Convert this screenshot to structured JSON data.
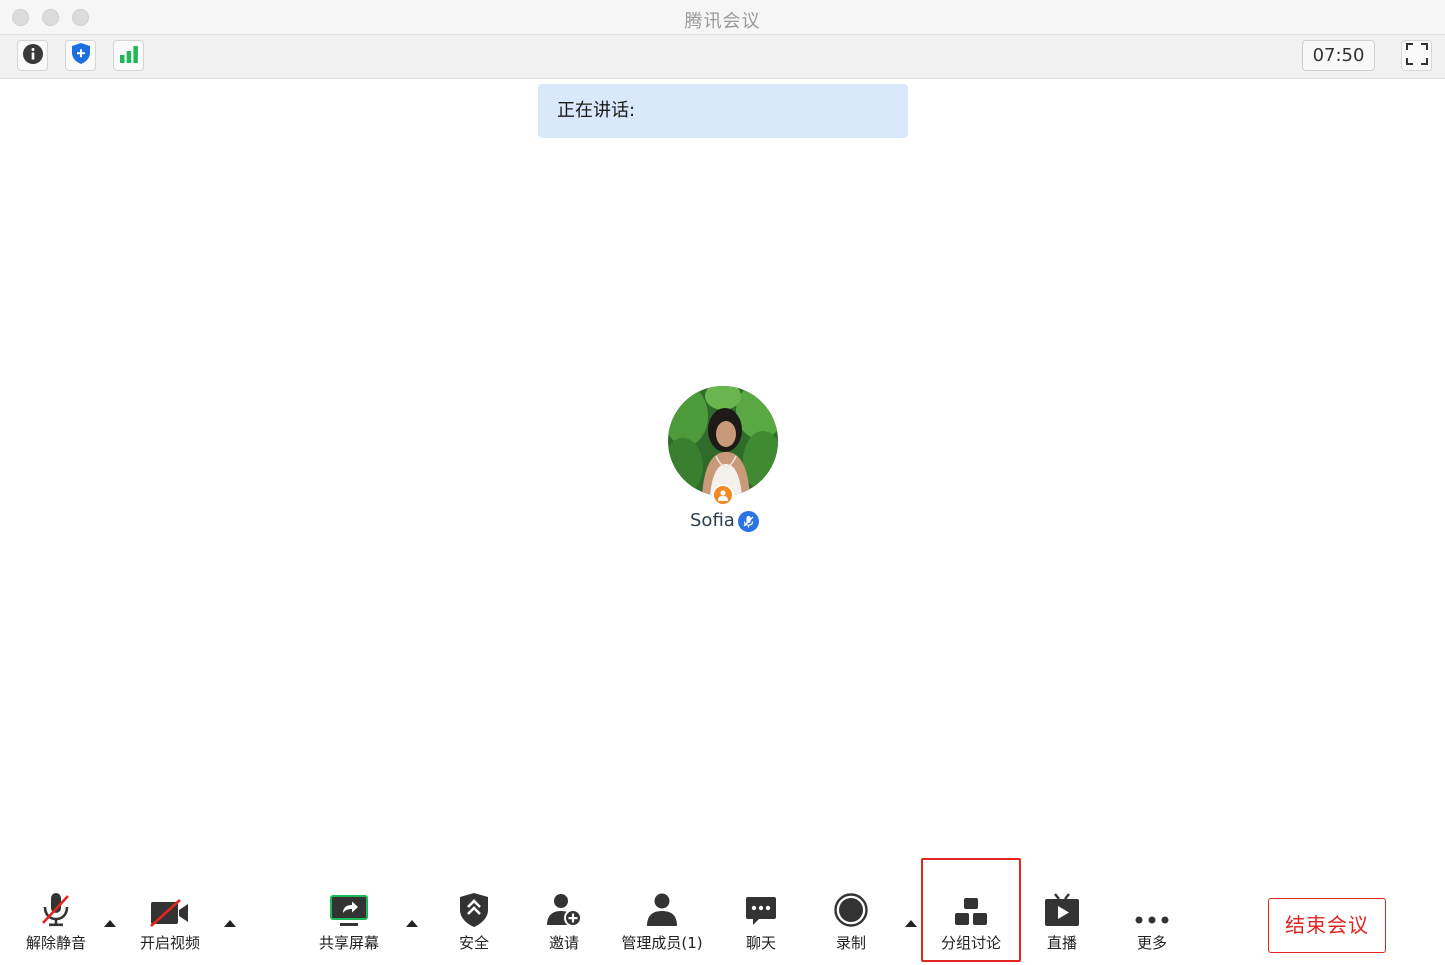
{
  "window": {
    "title": "腾讯会议"
  },
  "infobar": {
    "info_icon": "info-icon",
    "security_icon": "shield-icon",
    "signal_icon": "signal-bars-icon",
    "timer": "07:50",
    "fullscreen_icon": "fullscreen-icon"
  },
  "speaking": {
    "label": "正在讲话:"
  },
  "participant": {
    "name": "Sofia",
    "role_icon": "host-icon",
    "mic_icon": "microphone-icon"
  },
  "toolbar": {
    "unmute": "解除静音",
    "video": "开启视频",
    "share": "共享屏幕",
    "security": "安全",
    "invite": "邀请",
    "members": "管理成员(1)",
    "chat": "聊天",
    "record": "录制",
    "breakout": "分组讨论",
    "live": "直播",
    "more": "更多",
    "end": "结束会议"
  },
  "colors": {
    "accent_red": "#e0261f",
    "banner_blue": "#d9e9fb",
    "signal_green": "#1fb95b",
    "shield_blue": "#1d6fe0"
  }
}
